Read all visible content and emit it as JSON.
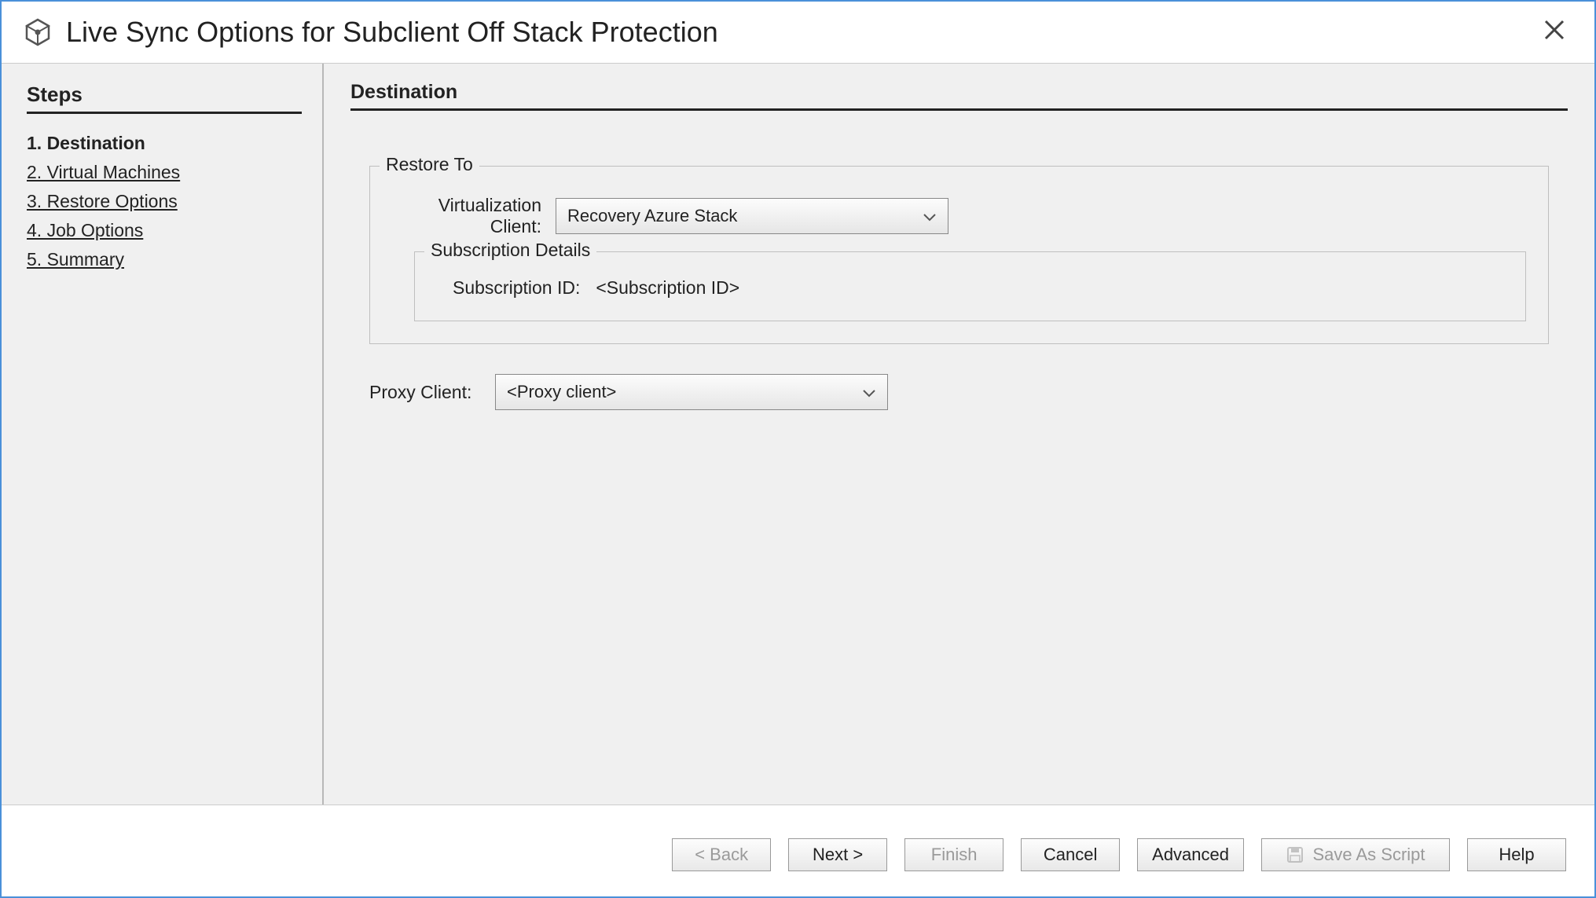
{
  "window": {
    "title": "Live Sync Options for Subclient Off Stack Protection"
  },
  "sidebar": {
    "heading": "Steps",
    "items": [
      {
        "label": "1. Destination",
        "active": true
      },
      {
        "label": "2. Virtual Machines",
        "active": false
      },
      {
        "label": "3. Restore Options",
        "active": false
      },
      {
        "label": "4. Job Options",
        "active": false
      },
      {
        "label": "5. Summary",
        "active": false
      }
    ]
  },
  "main": {
    "heading": "Destination",
    "restore_to": {
      "legend": "Restore To",
      "virt_client_label": "Virtualization Client:",
      "virt_client_value": "Recovery Azure Stack",
      "subscription": {
        "legend": "Subscription Details",
        "id_label": "Subscription ID:",
        "id_value": "<Subscription ID>"
      }
    },
    "proxy": {
      "label": "Proxy Client:",
      "value": "<Proxy client>"
    }
  },
  "footer": {
    "back": "< Back",
    "next": "Next >",
    "finish": "Finish",
    "cancel": "Cancel",
    "advanced": "Advanced",
    "save_script": "Save As Script",
    "help": "Help"
  }
}
